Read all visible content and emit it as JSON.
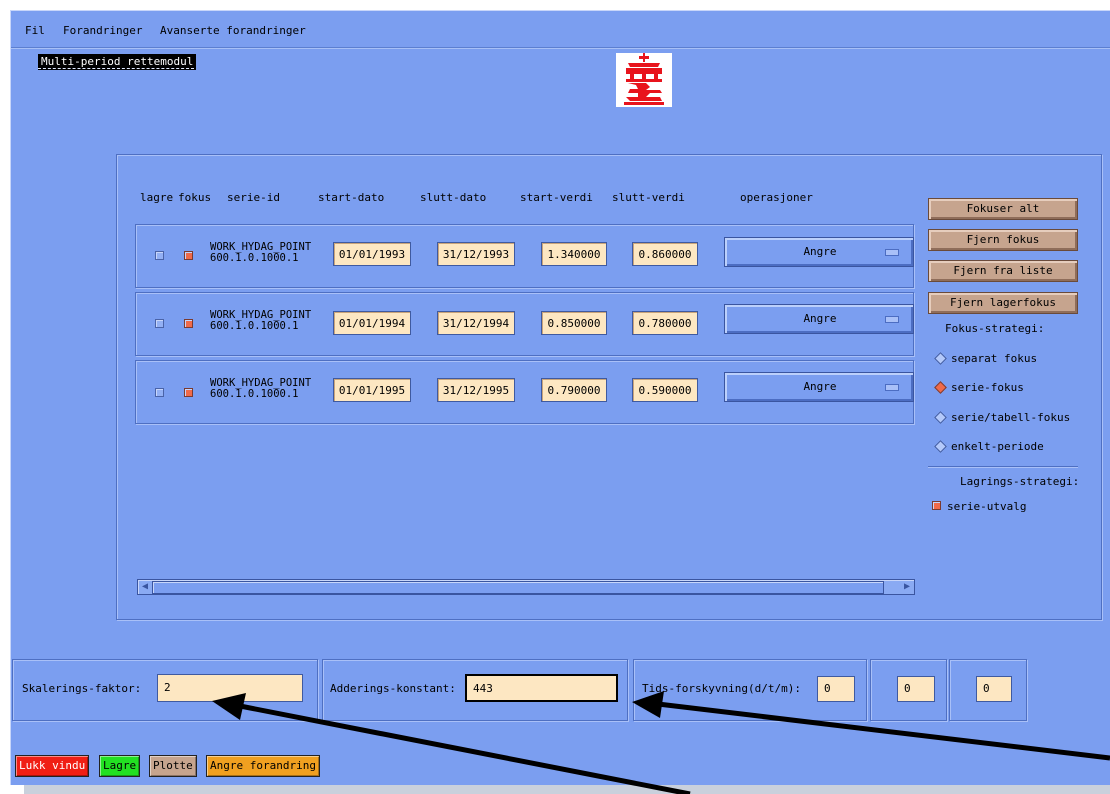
{
  "menu": [
    "Fil",
    "Forandringer",
    "Avanserte forandringer"
  ],
  "module_title": "Multi-period rettemodul",
  "colors": {
    "bg": "#7b9ef0",
    "field": "#fde7c2",
    "tan_button": "#c6a48e",
    "checked": "#f06a4a",
    "logo_red": "#e8141c"
  },
  "table": {
    "headers": [
      "lagre",
      "fokus",
      "serie-id",
      "start-dato",
      "slutt-dato",
      "start-verdi",
      "slutt-verdi",
      "operasjoner"
    ],
    "rows": [
      {
        "lagre": false,
        "fokus": true,
        "serie_line1": "WORK_HYDAG_POINT",
        "serie_line2": "600.1.0.1000.1",
        "start_dato": "01/01/1993",
        "slutt_dato": "31/12/1993",
        "start_verdi": "1.340000",
        "slutt_verdi": "0.860000",
        "operasjon": "Angre"
      },
      {
        "lagre": false,
        "fokus": true,
        "serie_line1": "WORK_HYDAG_POINT",
        "serie_line2": "600.1.0.1000.1",
        "start_dato": "01/01/1994",
        "slutt_dato": "31/12/1994",
        "start_verdi": "0.850000",
        "slutt_verdi": "0.780000",
        "operasjon": "Angre"
      },
      {
        "lagre": false,
        "fokus": true,
        "serie_line1": "WORK_HYDAG_POINT",
        "serie_line2": "600.1.0.1000.1",
        "start_dato": "01/01/1995",
        "slutt_dato": "31/12/1995",
        "start_verdi": "0.790000",
        "slutt_verdi": "0.590000",
        "operasjon": "Angre"
      }
    ]
  },
  "side": {
    "buttons": [
      "Fokuser alt",
      "Fjern fokus",
      "Fjern fra liste",
      "Fjern lagerfokus"
    ],
    "fokus_label": "Fokus-strategi:",
    "fokus_options": [
      {
        "label": "separat fokus",
        "selected": false
      },
      {
        "label": "serie-fokus",
        "selected": true
      },
      {
        "label": "serie/tabell-fokus",
        "selected": false
      },
      {
        "label": "enkelt-periode",
        "selected": false
      }
    ],
    "lagrings_label": "Lagrings-strategi:",
    "lagrings_option": "serie-utvalg"
  },
  "bottom": {
    "skalering_label": "Skalerings-faktor:",
    "skalering_value": "2",
    "addering_label": "Adderings-konstant:",
    "addering_value": "443",
    "tids_label": "Tids-forskyvning(d/t/m):",
    "tids_d": "0",
    "tids_t": "0",
    "tids_m": "0"
  },
  "status_buttons": [
    {
      "label": "Lukk vindu",
      "color": "#f01e14",
      "text": "#ffffff"
    },
    {
      "label": "Lagre",
      "color": "#22e022",
      "text": "#000000"
    },
    {
      "label": "Plotte",
      "color": "#c6a48e",
      "text": "#000000"
    },
    {
      "label": "Angre forandring",
      "color": "#f0a020",
      "text": "#000000"
    }
  ]
}
